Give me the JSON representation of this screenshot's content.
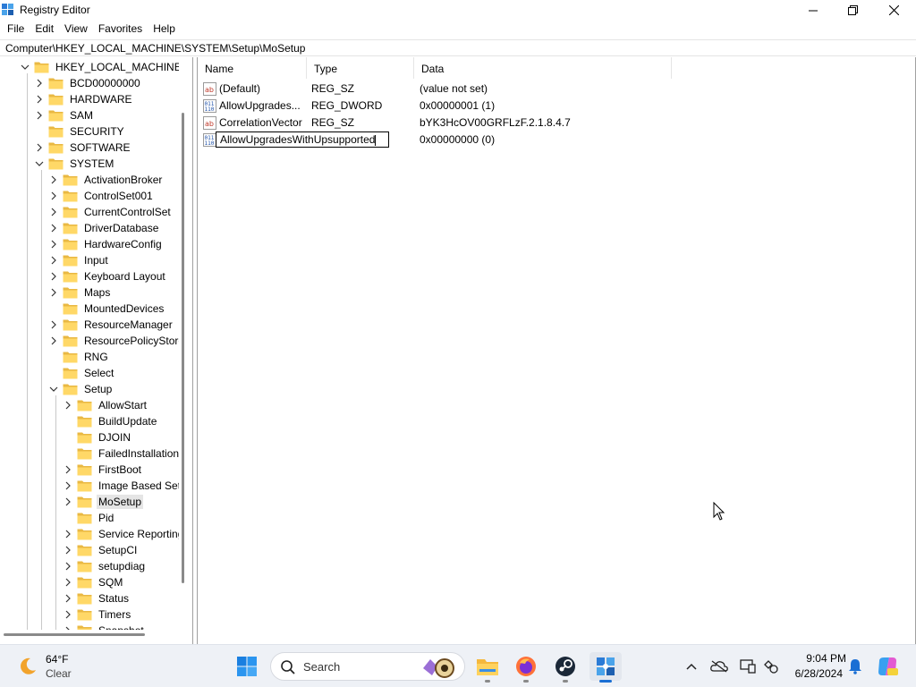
{
  "window": {
    "title": "Registry Editor",
    "app_icon": "registry-icon",
    "controls": [
      "minimize-icon",
      "maximize-icon",
      "close-icon"
    ]
  },
  "menu": [
    "File",
    "Edit",
    "View",
    "Favorites",
    "Help"
  ],
  "address": "Computer\\HKEY_LOCAL_MACHINE\\SYSTEM\\Setup\\MoSetup",
  "tree": {
    "items": [
      {
        "label": "HKEY_LOCAL_MACHINE",
        "level": 0,
        "state": "expanded"
      },
      {
        "label": "BCD00000000",
        "level": 1,
        "state": "collapsed"
      },
      {
        "label": "HARDWARE",
        "level": 1,
        "state": "collapsed"
      },
      {
        "label": "SAM",
        "level": 1,
        "state": "collapsed"
      },
      {
        "label": "SECURITY",
        "level": 1,
        "state": "none"
      },
      {
        "label": "SOFTWARE",
        "level": 1,
        "state": "collapsed"
      },
      {
        "label": "SYSTEM",
        "level": 1,
        "state": "expanded"
      },
      {
        "label": "ActivationBroker",
        "level": 2,
        "state": "collapsed"
      },
      {
        "label": "ControlSet001",
        "level": 2,
        "state": "collapsed"
      },
      {
        "label": "CurrentControlSet",
        "level": 2,
        "state": "collapsed"
      },
      {
        "label": "DriverDatabase",
        "level": 2,
        "state": "collapsed"
      },
      {
        "label": "HardwareConfig",
        "level": 2,
        "state": "collapsed"
      },
      {
        "label": "Input",
        "level": 2,
        "state": "collapsed"
      },
      {
        "label": "Keyboard Layout",
        "level": 2,
        "state": "collapsed"
      },
      {
        "label": "Maps",
        "level": 2,
        "state": "collapsed"
      },
      {
        "label": "MountedDevices",
        "level": 2,
        "state": "none"
      },
      {
        "label": "ResourceManager",
        "level": 2,
        "state": "collapsed"
      },
      {
        "label": "ResourcePolicyStore",
        "level": 2,
        "state": "collapsed"
      },
      {
        "label": "RNG",
        "level": 2,
        "state": "none"
      },
      {
        "label": "Select",
        "level": 2,
        "state": "none"
      },
      {
        "label": "Setup",
        "level": 2,
        "state": "expanded"
      },
      {
        "label": "AllowStart",
        "level": 3,
        "state": "collapsed"
      },
      {
        "label": "BuildUpdate",
        "level": 3,
        "state": "none"
      },
      {
        "label": "DJOIN",
        "level": 3,
        "state": "none"
      },
      {
        "label": "FailedInstallations",
        "level": 3,
        "state": "none"
      },
      {
        "label": "FirstBoot",
        "level": 3,
        "state": "collapsed"
      },
      {
        "label": "Image Based Setup",
        "level": 3,
        "state": "collapsed"
      },
      {
        "label": "MoSetup",
        "level": 3,
        "state": "collapsed",
        "selected": true
      },
      {
        "label": "Pid",
        "level": 3,
        "state": "none"
      },
      {
        "label": "Service Reporting",
        "level": 3,
        "state": "collapsed"
      },
      {
        "label": "SetupCI",
        "level": 3,
        "state": "collapsed"
      },
      {
        "label": "setupdiag",
        "level": 3,
        "state": "collapsed"
      },
      {
        "label": "SQM",
        "level": 3,
        "state": "collapsed"
      },
      {
        "label": "Status",
        "level": 3,
        "state": "collapsed"
      },
      {
        "label": "Timers",
        "level": 3,
        "state": "collapsed"
      },
      {
        "label": "Snapshot",
        "level": 3,
        "state": "collapsed"
      }
    ]
  },
  "values": {
    "columns": [
      "Name",
      "Type",
      "Data"
    ],
    "rows": [
      {
        "icon": "string-value-icon",
        "name": "(Default)",
        "type": "REG_SZ",
        "data": "(value not set)"
      },
      {
        "icon": "binary-value-icon",
        "name": "AllowUpgrades...",
        "type": "REG_DWORD",
        "data": "0x00000001 (1)"
      },
      {
        "icon": "string-value-icon",
        "name": "CorrelationVector",
        "type": "REG_SZ",
        "data": "bYK3HcOV00GRFLzF.2.1.8.4.7"
      },
      {
        "icon": "binary-value-icon",
        "name": "AllowUpgradesWithUpsupported",
        "type": "",
        "data": "0x00000000 (0)",
        "editing": true
      }
    ]
  },
  "taskbar": {
    "weather": {
      "temp": "64°F",
      "desc": "Clear",
      "icon": "moon-icon"
    },
    "search_label": "Search",
    "apps": [
      "start-icon",
      "file-explorer-icon",
      "firefox-icon",
      "steam-icon",
      "registry-editor-icon"
    ],
    "tray_icons": [
      "chevron-up-icon",
      "onedrive-icon",
      "display-icon",
      "network-icon",
      "notification-bell-icon",
      "copilot-icon"
    ],
    "time": "9:04 PM",
    "date": "6/28/2024"
  }
}
